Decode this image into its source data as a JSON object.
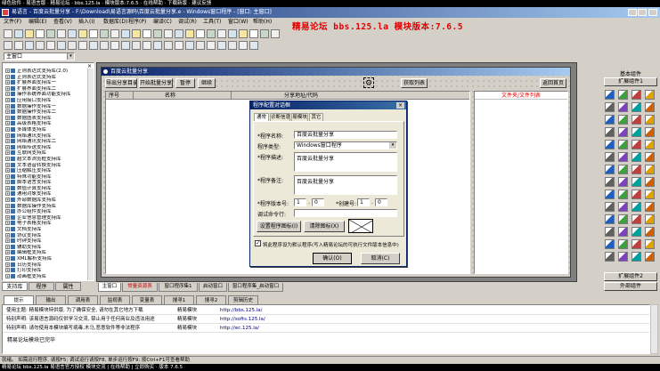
{
  "banner": {
    "text": "绿色软件 · 易语言版 · 精易论坛 · bbs.125.la · 模块版本:7.6.5 · 在线帮助 · 下载新版 · 建议反馈",
    "watermark": "精易论坛 bbs.125.la 模块版本:7.6.5"
  },
  "titlebar": {
    "text": "易语言 - 百度云批量分享 - F:\\Download\\易语言源码\\百度云批量分享.e - Windows窗口程序 - [窗口: 主窗口]"
  },
  "menu": [
    "文件(F)",
    "编辑(E)",
    "查看(V)",
    "插入(I)",
    "数据库(D)",
    "程序(P)",
    "编译(C)",
    "调试(R)",
    "工具(T)",
    "窗口(W)",
    "帮助(H)"
  ],
  "combo": {
    "value": "主窗口"
  },
  "left_panel": {
    "items": [
      "正则表达式支持库(2.0)",
      "正则表达式支持库",
      "扩展界面支持库一",
      "扩展界面支持库二",
      "操作系统界面功能支持库",
      "应用接口支持库",
      "数据操作支持库一",
      "数据操作支持库二",
      "数据图表支持库",
      "高级表格支持库",
      "多媒体支持库",
      "网络通讯支持库",
      "网络通讯支持库二",
      "网络传送支持库",
      "互联网支持库",
      "超文本浏览框支持库",
      "文本语音转换支持库",
      "压缩解压支持库",
      "特殊功能支持库",
      "脚本语言支持库",
      "数值计算支持库",
      "通用对象支持库",
      "外部数据库支持库",
      "数据库操作支持库",
      "办公组件支持库",
      "企业信息管理支持库",
      "电子表格支持库",
      "文档支持库",
      "协议支持库",
      "时钟支持库",
      "辅助支持库",
      "编辑框支持库",
      "XML解析支持库",
      "日历支持库",
      "打印支持库",
      "动画框支持库"
    ],
    "tabs": [
      "支持库",
      "程序",
      "属性"
    ]
  },
  "designer": {
    "title": "百度云批量分享",
    "toolbar": [
      "导出分享目录",
      "开始批量分享",
      "暂停",
      "继续"
    ],
    "right_buttons": [
      "获取列表",
      "返回首页"
    ],
    "columns": [
      "序号",
      "名称",
      "分享地址/代码",
      "文件夹/文件列表"
    ]
  },
  "dialog": {
    "title": "程序配置对话框",
    "tabs": [
      "通常",
      "诊断信息",
      "易模块",
      "其它"
    ],
    "program_name_label": "*程序名称:",
    "program_name": "百度云批量分享",
    "program_type_label": "程序类型:",
    "program_type": "Windows窗口程序",
    "description_label": "*程序描述:",
    "description": "百度云批量分享",
    "note_label": "*程序备注:",
    "note": "百度云批量分享",
    "version_label": "*程序版本号:",
    "version_major": "1",
    "version_minor": "0",
    "build_label": "*创建号:",
    "build_a": "1",
    "build_b": "0",
    "debug_label": "调试命令行:",
    "set_icon_button": "设置程序图标(I)",
    "clear_icon_button": "清除图标(X)",
    "checkbox_label": "将此程序设为默认程序(写入精易论坛的可执行文件版本信息中)",
    "ok_button": "确认(O)",
    "cancel_button": "取消(C)"
  },
  "doc_tabs": [
    "主窗口",
    "常量资源表",
    "窗口程序集1",
    "启动窗口",
    "窗口程序集_启动窗口"
  ],
  "right_panel": {
    "title": "基本组件",
    "tab": "扩展组件1",
    "bottom1": "扩展组件2",
    "bottom2": "外部组件"
  },
  "output": {
    "tabs": [
      "提示",
      "输出",
      "调用表",
      "监视表",
      "变量表",
      "搜寻1",
      "搜寻2",
      "剪辑历史"
    ],
    "rows": [
      [
        "使用主题: 精易模块特供版, 为了确保安全, 请勿在其它地方下载",
        "精易模块",
        "http://bbs.125.la/"
      ],
      [
        "特别声明: 该易语言源码仅供学习交流, 禁止用于任何商业及违法用途",
        "精易模块",
        "http://softs.125.la/"
      ],
      [
        "特别声明: 请勿使用本模块编写病毒,木马,恶意软件等非法程序",
        "精易模块",
        "http://ec.125.la/"
      ]
    ],
    "status": "精易论坛模块已完毕"
  },
  "statusbar": {
    "text": "就绪。 如需运行程序, 请按F5; 调试运行请按F8, 单步运行按F9; 按Ctrl+F1可查看帮助",
    "bottom": "精易论坛 bbs.125.la 易语言官方授权 模块交流 | 在线帮助 | 立即购买 · 版本 7.6.5"
  },
  "colors": {
    "accent": "#c00000",
    "title": "#0a246a",
    "dialog_bg": "#ece9d8",
    "watermark": "#e00000"
  }
}
